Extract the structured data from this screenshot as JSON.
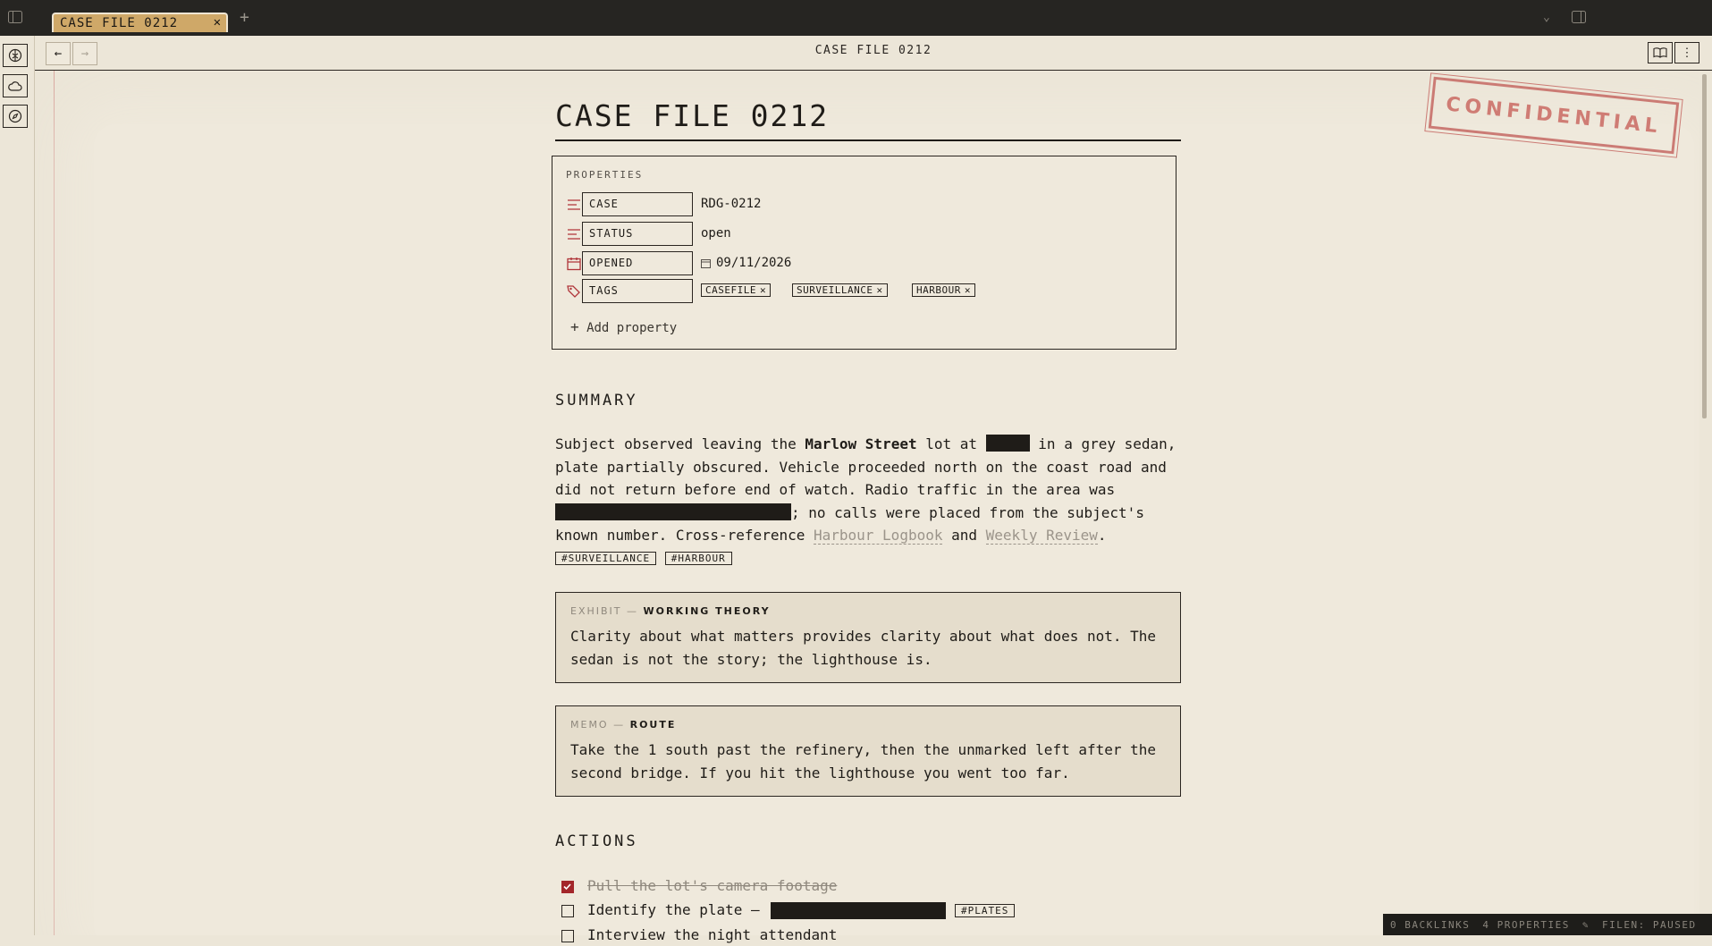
{
  "tab": {
    "title": "CASE FILE 0212"
  },
  "header": {
    "title": "CASE FILE 0212"
  },
  "stamp": "CONFIDENTIAL",
  "document": {
    "title": "CASE FILE 0212",
    "properties_heading": "PROPERTIES",
    "properties": [
      {
        "key": "CASE",
        "value": "RDG-0212",
        "icon": "text-lines-icon"
      },
      {
        "key": "STATUS",
        "value": "open",
        "icon": "text-lines-icon"
      },
      {
        "key": "OPENED",
        "value": "09/11/2026",
        "icon": "calendar-icon"
      },
      {
        "key": "TAGS",
        "icon": "tags-icon",
        "tags": [
          "CASEFILE",
          "SURVEILLANCE",
          "HARBOUR"
        ]
      }
    ],
    "add_property": "Add property",
    "summary_heading": "SUMMARY",
    "summary": {
      "p1": "Subject observed leaving the ",
      "street": "Marlow Street",
      "p2": " lot at ",
      "p3": " in a grey sedan, plate partially obscured. Vehicle proceeded north on the coast road and did not return before end of watch. Radio traffic in the area was ",
      "p4": "; no calls were placed from the subject's known number. Cross-reference ",
      "link1": "Harbour Logbook",
      "p5": " and ",
      "link2": "Weekly Review",
      "p6": ".",
      "tags": [
        "#SURVEILLANCE",
        "#HARBOUR"
      ]
    },
    "callouts": [
      {
        "kind": "EXHIBIT —",
        "name": "WORKING THEORY",
        "body": "Clarity about what matters provides clarity about what does not. The sedan is not the story; the lighthouse is."
      },
      {
        "kind": "MEMO —",
        "name": "ROUTE",
        "body": "Take the 1 south past the refinery, then the unmarked left after the second bridge. If you hit the lighthouse you went too far."
      }
    ],
    "actions_heading": "ACTIONS",
    "actions": [
      {
        "text": "Pull the lot's camera footage",
        "done": true
      },
      {
        "text": "Identify the plate —",
        "done": false,
        "tag": "#PLATES"
      },
      {
        "text": "Interview the night attendant",
        "done": false
      }
    ]
  },
  "statusbar": {
    "backlinks": "0 BACKLINKS",
    "properties": "4 PROPERTIES",
    "sync": "FILEN: PAUSED"
  }
}
